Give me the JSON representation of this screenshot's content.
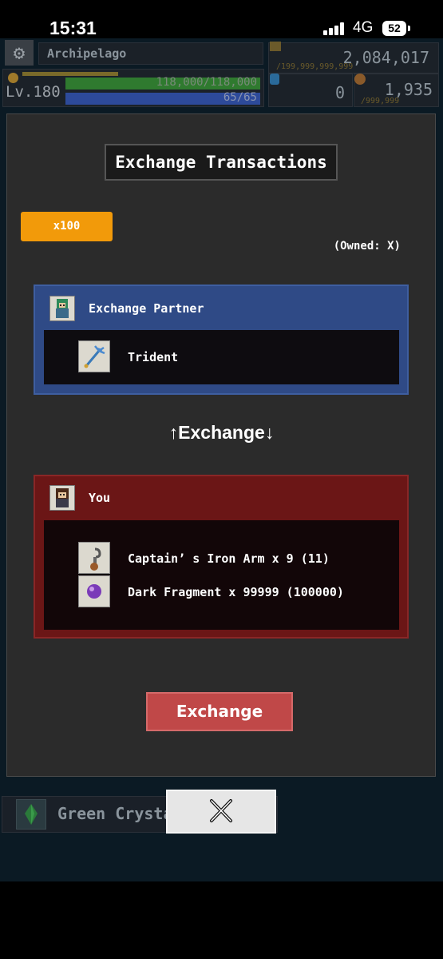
{
  "status_bar": {
    "time": "15:31",
    "network": "4G",
    "battery": "52"
  },
  "hud": {
    "location": "Archipelago",
    "level": "Lv.180",
    "hp": "118,000/118,000",
    "mp": "65/65",
    "gold_cap": "/199,999,999,999",
    "gold": "2,084,017",
    "gems": "0",
    "medal_cap": "/999,999",
    "medals": "1,935",
    "icons": [
      "gear-icon",
      "coin-icon",
      "gold-bag-icon",
      "gem-icon",
      "medal-icon"
    ]
  },
  "dialog": {
    "title": "Exchange Transactions",
    "multiplier": "x100",
    "owned": "(Owned: X)",
    "partner": {
      "title": "Exchange Partner",
      "items": [
        {
          "name": "Trident",
          "icon": "trident-icon"
        }
      ]
    },
    "arrows": "↑Exchange↓",
    "you": {
      "title": "You",
      "items": [
        {
          "name": "Captain’ s Iron Arm x 9 (11)",
          "icon": "iron-arm-icon"
        },
        {
          "name": "Dark Fragment x 99999 (100000)",
          "icon": "dark-fragment-icon"
        }
      ]
    },
    "exchange_button": "Exchange"
  },
  "background": {
    "list_item_label": "Green Crysta"
  },
  "colors": {
    "accent_orange": "#f29a0a",
    "partner_blue": "#2f4a86",
    "you_red": "#6b1616",
    "button_red": "#c04848"
  }
}
